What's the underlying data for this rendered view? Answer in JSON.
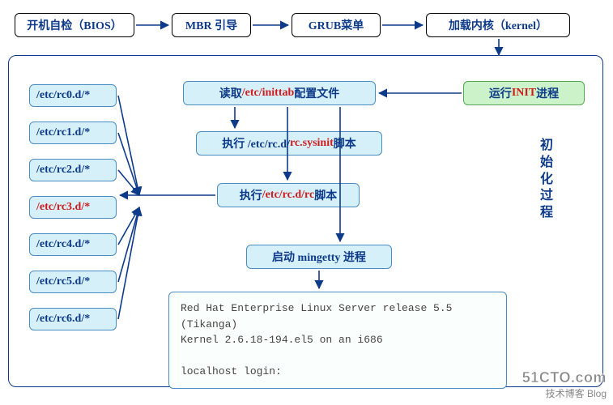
{
  "top_row": {
    "bios": "开机自检（BIOS）",
    "mbr": "MBR 引导",
    "grub": "GRUB菜单",
    "kernel": "加载内核（kernel）"
  },
  "main": {
    "init": {
      "pre": "运行 ",
      "red": "INIT",
      "post": " 进程"
    },
    "inittab": {
      "pre": "读取",
      "red": "/etc/inittab",
      "post": "配置文件"
    },
    "sysinit": {
      "pre": "执行 /etc/rc.d/",
      "red": "rc.sysinit",
      "post": " 脚本"
    },
    "rc": {
      "pre": "执行",
      "red": "/etc/rc.d/rc",
      "post": "脚本"
    },
    "mingetty": "启动 mingetty 进程",
    "rc_dirs": [
      {
        "text": "/etc/rc0.d/*",
        "highlighted": false
      },
      {
        "text": "/etc/rc1.d/*",
        "highlighted": false
      },
      {
        "text": "/etc/rc2.d/*",
        "highlighted": false
      },
      {
        "text": "/etc/rc3.d/*",
        "highlighted": true
      },
      {
        "text": "/etc/rc4.d/*",
        "highlighted": false
      },
      {
        "text": "/etc/rc5.d/*",
        "highlighted": false
      },
      {
        "text": "/etc/rc6.d/*",
        "highlighted": false
      }
    ],
    "terminal": "Red Hat Enterprise Linux Server release 5.5 (Tikanga)\nKernel 2.6.18-194.el5 on an i686\n\nlocalhost login:",
    "side_label": "初始化过程"
  },
  "watermark": {
    "line1": "51CTO.com",
    "line2": "技术博客  Blog"
  }
}
